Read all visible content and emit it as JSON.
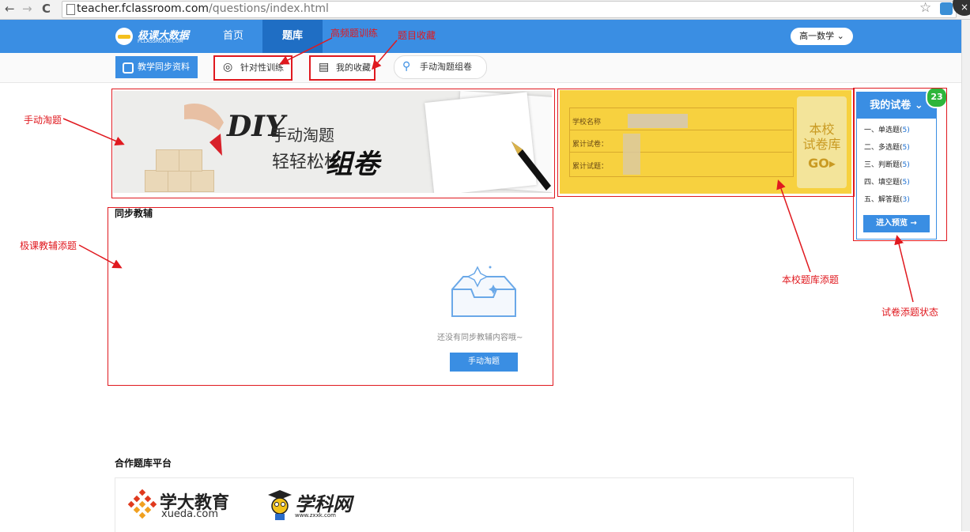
{
  "browser": {
    "back": "←",
    "forward": "→",
    "reload": "C",
    "url_host": "teacher.fclassroom.com",
    "url_path": "/questions/index.html",
    "close": "×"
  },
  "header": {
    "logo_title": "极课大数据",
    "logo_sub": "FCLASSROOM.COM",
    "nav_home": "首页",
    "nav_bank": "题库",
    "grade_selector": "高一数学"
  },
  "subnav": {
    "sync": "教学同步资料",
    "train": "针对性训练",
    "favorites": "我的收藏",
    "manual": "手动淘题组卷"
  },
  "banner": {
    "diy": "DIY",
    "line1": "手动淘题",
    "line2": "轻轻松松",
    "line3": "组卷"
  },
  "school_card": {
    "school_name_label": "学校名称",
    "papers_label": "累计试卷：",
    "questions_label": "累计试题：",
    "go_line1": "本校",
    "go_line2": "试卷库",
    "go_line3": "GO"
  },
  "my_paper": {
    "title": "我的试卷",
    "count": "23",
    "types": [
      {
        "label": "一、单选题(",
        "num": "5",
        "close": ")"
      },
      {
        "label": "二、多选题(",
        "num": "5",
        "close": ")"
      },
      {
        "label": "三、判断题(",
        "num": "5",
        "close": ")"
      },
      {
        "label": "四、填空题(",
        "num": "5",
        "close": ")"
      },
      {
        "label": "五、解答题(",
        "num": "3",
        "close": ")"
      }
    ],
    "preview_button": "进入预览"
  },
  "sync_section": {
    "title": "同步教辅",
    "empty_text": "还没有同步教辅内容哦~",
    "manual_button": "手动淘题"
  },
  "partners": {
    "title": "合作题库平台",
    "xueda_name": "学大教育",
    "xueda_url": "xueda.com",
    "zxxk_name": "学科网",
    "zxxk_url": "www.zxxk.com"
  },
  "annotations": {
    "train_note": "高频题训练",
    "fav_note": "题目收藏",
    "manual_note": "手动淘题",
    "tutor_note": "极课教辅添题",
    "school_note": "本校题库添题",
    "paper_note": "试卷添题状态"
  },
  "colors": {
    "primary": "#3a8ee3",
    "active_nav": "#1f6ec4",
    "annotation_red": "#e0191f",
    "school_yellow": "#f7d13f",
    "badge_green": "#2eb53b"
  }
}
